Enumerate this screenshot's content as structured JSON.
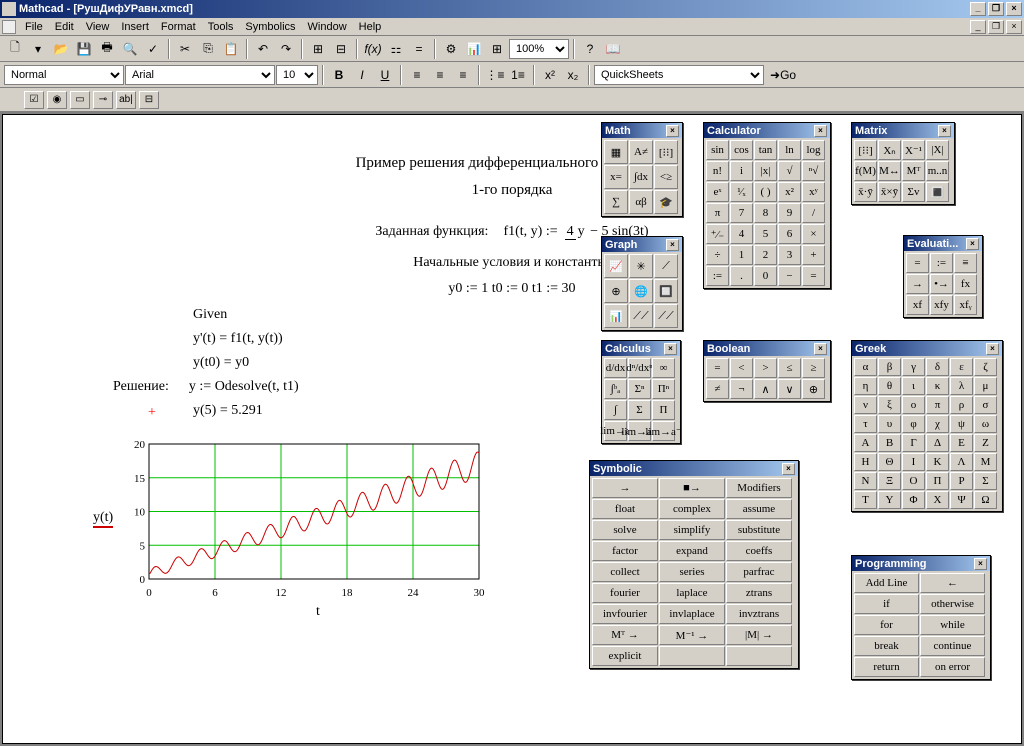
{
  "app": {
    "title": "Mathcad - [РушДифУРавн.xmcd]"
  },
  "menu": {
    "items": [
      "File",
      "Edit",
      "View",
      "Insert",
      "Format",
      "Tools",
      "Symbolics",
      "Window",
      "Help"
    ]
  },
  "toolbar2": {
    "style_value": "Normal",
    "font_value": "Arial",
    "size_value": "10",
    "quicksheets": "QuickSheets",
    "go": "Go"
  },
  "zoom": "100%",
  "doc": {
    "title_l1": "Пример решения дифференциального уравнения",
    "title_l2": "1-го порядка",
    "label_func": "Заданная функция:",
    "func_lhs": "f1(t, y)  :=",
    "func_frac_num": "4",
    "func_frac_den": "y",
    "func_rest": " − 5 sin(3t)",
    "label_init": "Начальные условия и константы:",
    "init_vals": "y0 := 1      t0 := 0       t1 := 30",
    "given": "Given",
    "eq1": "y'(t) = f1(t, y(t))",
    "eq2": "y(t0) = y0",
    "label_sol": "Решение:",
    "sol_expr": "y := Odesolve(t, t1)",
    "sol_val": "y(5) = 5.291",
    "red_plus": "+",
    "chart_ylabel": "y(t)",
    "chart_xlabel": "t"
  },
  "chart_data": {
    "type": "line",
    "xlabel": "t",
    "ylabel": "y(t)",
    "xlim": [
      0,
      30
    ],
    "ylim": [
      0,
      20
    ],
    "xticks": [
      0,
      6,
      12,
      18,
      24,
      30
    ],
    "yticks": [
      0,
      5,
      10,
      15,
      20
    ],
    "series": [
      {
        "name": "y(t)",
        "color": "#cc0000",
        "x": [
          0,
          1,
          2,
          3,
          4,
          5,
          6,
          7,
          8,
          9,
          10,
          11,
          12,
          13,
          14,
          15,
          16,
          17,
          18,
          19,
          20,
          21,
          22,
          23,
          24,
          25,
          26,
          27,
          28,
          29,
          30
        ],
        "y": [
          1,
          4.5,
          1.8,
          5.2,
          3.0,
          5.3,
          4.8,
          6.2,
          5.8,
          7.9,
          6.5,
          9.0,
          7.5,
          10.5,
          8.5,
          11.0,
          9.0,
          11.7,
          10.0,
          12.3,
          11.0,
          13.2,
          12.0,
          14.0,
          12.5,
          14.8,
          13.0,
          15.5,
          14.0,
          17.0,
          15.0
        ]
      }
    ]
  },
  "palettes": {
    "math": {
      "title": "Math",
      "icons": [
        "▦",
        "A≠",
        "[⁝⁝]",
        "x=",
        "∫dx",
        "<≥",
        "∑",
        "αβ",
        "🎓"
      ]
    },
    "graph": {
      "title": "Graph",
      "icons": [
        "📈",
        "✳",
        "⟋",
        "⊕",
        "🌐",
        "🔲",
        "📊",
        "⟋⟋",
        "⟋⟋"
      ]
    },
    "calculator": {
      "title": "Calculator",
      "buttons": [
        "sin",
        "cos",
        "tan",
        "ln",
        "log",
        "n!",
        "i",
        "|x|",
        "√",
        "ⁿ√",
        "eˣ",
        "¹⁄ₓ",
        "( )",
        "x²",
        "xʸ",
        "π",
        "7",
        "8",
        "9",
        "/",
        "⁺⁄₋",
        "4",
        "5",
        "6",
        "×",
        "÷",
        "1",
        "2",
        "3",
        "+",
        ":=",
        ".",
        "0",
        "−",
        "="
      ]
    },
    "matrix": {
      "title": "Matrix",
      "buttons": [
        "[⁝⁝]",
        "Xₙ",
        "X⁻¹",
        "|X|",
        "f(M)",
        "M↔",
        "Mᵀ",
        "m..n",
        "x̄·ȳ",
        "x̄×ȳ",
        "Σv",
        "🔳"
      ]
    },
    "evaluation": {
      "title": "Evaluati...",
      "buttons": [
        "=",
        ":=",
        "≡",
        "→",
        "•→",
        "fx",
        "xf",
        "xfy",
        "xfᵧ"
      ]
    },
    "calculus": {
      "title": "Calculus",
      "buttons": [
        "d/dx",
        "dⁿ/dxⁿ",
        "∞",
        "∫ᵇₐ",
        "Σⁿ",
        "Πⁿ",
        "∫",
        "Σ",
        "Π",
        "lim→a",
        "lim→a⁺",
        "lim→a⁻"
      ]
    },
    "boolean": {
      "title": "Boolean",
      "buttons": [
        "=",
        "<",
        ">",
        "≤",
        "≥",
        "≠",
        "¬",
        "∧",
        "∨",
        "⊕"
      ]
    },
    "greek": {
      "title": "Greek",
      "buttons": [
        "α",
        "β",
        "γ",
        "δ",
        "ε",
        "ζ",
        "η",
        "θ",
        "ι",
        "κ",
        "λ",
        "μ",
        "ν",
        "ξ",
        "ο",
        "π",
        "ρ",
        "σ",
        "τ",
        "υ",
        "φ",
        "χ",
        "ψ",
        "ω",
        "Α",
        "Β",
        "Γ",
        "Δ",
        "Ε",
        "Ζ",
        "Η",
        "Θ",
        "Ι",
        "Κ",
        "Λ",
        "Μ",
        "Ν",
        "Ξ",
        "Ο",
        "Π",
        "Ρ",
        "Σ",
        "Τ",
        "Υ",
        "Φ",
        "Χ",
        "Ψ",
        "Ω"
      ]
    },
    "programming": {
      "title": "Programming",
      "buttons": [
        "Add Line",
        "←",
        "if",
        "otherwise",
        "for",
        "while",
        "break",
        "continue",
        "return",
        "on error"
      ]
    },
    "symbolic": {
      "title": "Symbolic",
      "buttons": [
        "→",
        "■→",
        "Modifiers",
        "float",
        "complex",
        "assume",
        "solve",
        "simplify",
        "substitute",
        "factor",
        "expand",
        "coeffs",
        "collect",
        "series",
        "parfrac",
        "fourier",
        "laplace",
        "ztrans",
        "invfourier",
        "invlaplace",
        "invztrans",
        "Mᵀ →",
        "M⁻¹ →",
        "|M| →",
        "explicit",
        "",
        ""
      ]
    }
  }
}
